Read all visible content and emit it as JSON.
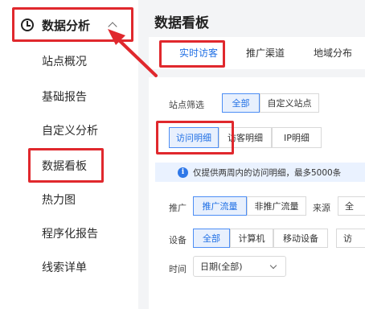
{
  "sidebar": {
    "header": {
      "icon": "clock-icon",
      "title": "数据分析",
      "expanded": true
    },
    "items": [
      {
        "label": "站点概况"
      },
      {
        "label": "基础报告"
      },
      {
        "label": "自定义分析"
      },
      {
        "label": "数据看板",
        "highlighted": true
      },
      {
        "label": "热力图"
      },
      {
        "label": "程序化报告"
      },
      {
        "label": "线索详单"
      }
    ]
  },
  "main": {
    "title": "数据看板",
    "tabs": [
      {
        "label": "实时访客",
        "active": true
      },
      {
        "label": "推广渠道"
      },
      {
        "label": "地域分布"
      }
    ],
    "filters": {
      "site_label": "站点筛选",
      "site_options": [
        "全部",
        "自定义站点"
      ],
      "detail_tabs": [
        "访问明细",
        "访客明细",
        "IP明细"
      ],
      "notice": "仅提供两周内的访问明细，最多5000条",
      "promo_label": "推广",
      "promo_options": [
        "推广流量",
        "非推广流量"
      ],
      "source_label": "来源",
      "source_value_partial": "全",
      "device_label": "设备",
      "device_options": [
        "全部",
        "计算机",
        "移动设备"
      ],
      "device_more_partial": "访",
      "time_label": "时间",
      "time_value": "日期(全部)"
    }
  },
  "colors": {
    "accent": "#1f6fe5",
    "annotation_red": "#e0282d",
    "notice_bg": "#eaf2ff"
  }
}
